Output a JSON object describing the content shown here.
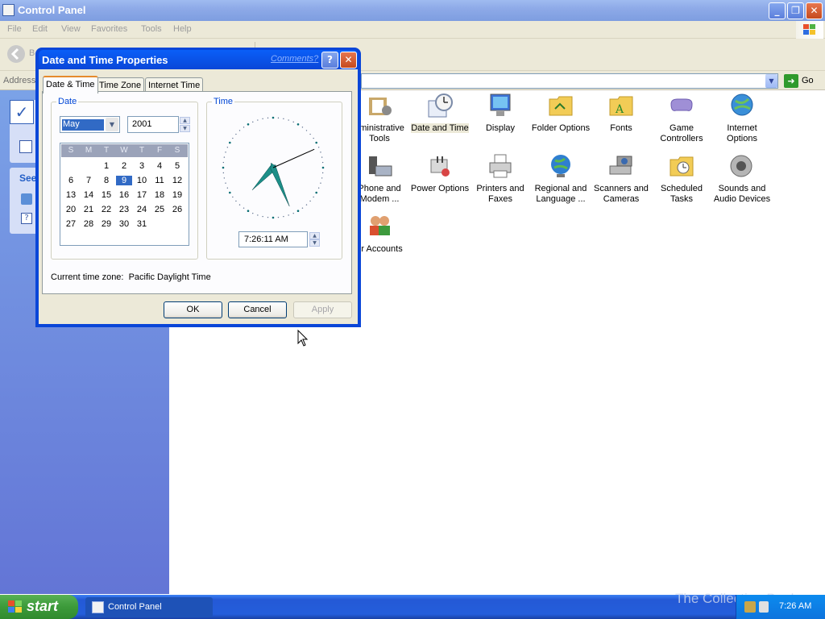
{
  "window": {
    "title": "Control Panel"
  },
  "menu": [
    "File",
    "Edit",
    "View",
    "Favorites",
    "Tools",
    "Help"
  ],
  "toolbar": {
    "back_label": "B"
  },
  "address": {
    "label": "Address",
    "value": "",
    "go_label": "Go"
  },
  "left_pane": {
    "see_also_label": "See"
  },
  "icons": [
    {
      "label": "dministrative Tools",
      "icon": "administrative-tools-icon"
    },
    {
      "label": "Date and Time",
      "icon": "date-and-time-icon",
      "selected": true
    },
    {
      "label": "Display",
      "icon": "display-icon"
    },
    {
      "label": "Folder Options",
      "icon": "folder-options-icon"
    },
    {
      "label": "Fonts",
      "icon": "fonts-icon"
    },
    {
      "label": "Game Controllers",
      "icon": "game-controllers-icon"
    },
    {
      "label": "Internet Options",
      "icon": "internet-options-icon"
    },
    {
      "label": "Phone and Modem ...",
      "icon": "phone-modem-icon"
    },
    {
      "label": "Power Options",
      "icon": "power-options-icon"
    },
    {
      "label": "Printers and Faxes",
      "icon": "printers-faxes-icon"
    },
    {
      "label": "Regional and Language ...",
      "icon": "regional-language-icon"
    },
    {
      "label": "Scanners and Cameras",
      "icon": "scanners-cameras-icon"
    },
    {
      "label": "Scheduled Tasks",
      "icon": "scheduled-tasks-icon"
    },
    {
      "label": "Sounds and Audio Devices",
      "icon": "sounds-audio-icon"
    },
    {
      "label": "er Accounts",
      "icon": "user-accounts-icon"
    }
  ],
  "dialog": {
    "title": "Date and Time Properties",
    "comments_link": "Comments?",
    "tabs": [
      "Date & Time",
      "Time Zone",
      "Internet Time"
    ],
    "date_group": "Date",
    "time_group": "Time",
    "month": "May",
    "year": "2001",
    "weekdays": [
      "S",
      "M",
      "T",
      "W",
      "T",
      "F",
      "S"
    ],
    "calendar_weeks": [
      [
        "",
        "",
        "1",
        "2",
        "3",
        "4",
        "5"
      ],
      [
        "6",
        "7",
        "8",
        "9",
        "10",
        "11",
        "12"
      ],
      [
        "13",
        "14",
        "15",
        "16",
        "17",
        "18",
        "19"
      ],
      [
        "20",
        "21",
        "22",
        "23",
        "24",
        "25",
        "26"
      ],
      [
        "27",
        "28",
        "29",
        "30",
        "31",
        "",
        ""
      ]
    ],
    "selected_day": "9",
    "time": "7:26:11 AM",
    "clock": {
      "hour": 7,
      "minute": 26,
      "second": 11
    },
    "timezone_text": "Current time zone:  Pacific Daylight Time",
    "ok_label": "OK",
    "cancel_label": "Cancel",
    "apply_label": "Apply"
  },
  "taskbar": {
    "start_label": "start",
    "task_label": "Control Panel",
    "clock": "7:26 AM"
  },
  "watermark": "The Collection Book"
}
